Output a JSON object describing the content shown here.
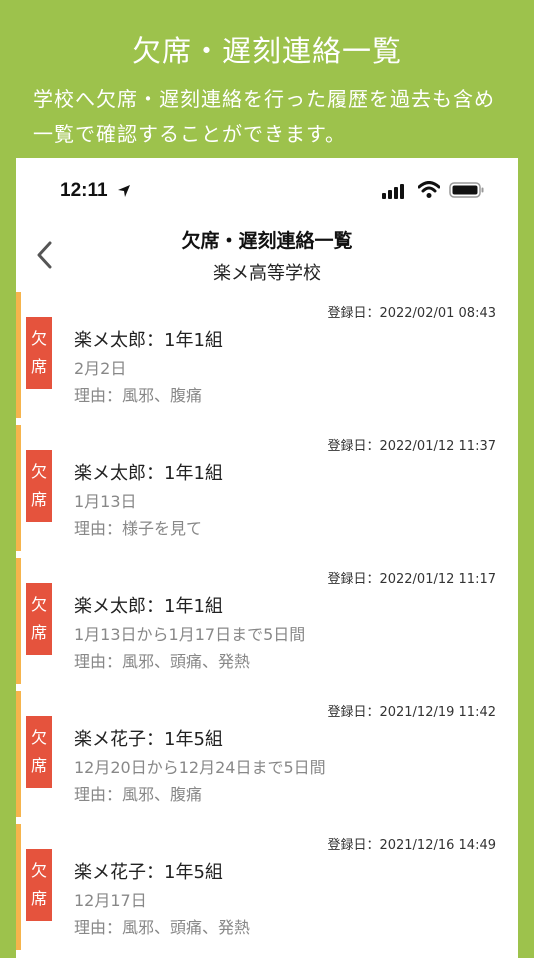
{
  "promo": {
    "title": "欠席・遅刻連絡一覧",
    "description": "学校へ欠席・遅刻連絡を行った履歴を過去も含め一覧で確認することができます。"
  },
  "status_bar": {
    "time": "12:11"
  },
  "nav": {
    "title": "欠席・遅刻連絡一覧",
    "subtitle": "楽メ高等学校"
  },
  "records": [
    {
      "badge": "欠席",
      "registered": "登録日：2022/02/01 08:43",
      "student": "楽メ太郎：1年1組",
      "dates": "2月2日",
      "reason": "理由：風邪、腹痛"
    },
    {
      "badge": "欠席",
      "registered": "登録日：2022/01/12 11:37",
      "student": "楽メ太郎：1年1組",
      "dates": "1月13日",
      "reason": "理由：様子を見て"
    },
    {
      "badge": "欠席",
      "registered": "登録日：2022/01/12 11:17",
      "student": "楽メ太郎：1年1組",
      "dates": "1月13日から1月17日まで5日間",
      "reason": "理由：風邪、頭痛、発熱"
    },
    {
      "badge": "欠席",
      "registered": "登録日：2021/12/19 11:42",
      "student": "楽メ花子：1年5組",
      "dates": "12月20日から12月24日まで5日間",
      "reason": "理由：風邪、腹痛"
    },
    {
      "badge": "欠席",
      "registered": "登録日：2021/12/16 14:49",
      "student": "楽メ花子：1年5組",
      "dates": "12月17日",
      "reason": "理由：風邪、頭痛、発熱"
    }
  ],
  "colors": {
    "background": "#9dc24c",
    "badge": "#e5533d",
    "stripe": "#f6b44c"
  },
  "icons": [
    "location-arrow-icon",
    "signal-icon",
    "wifi-icon",
    "battery-icon",
    "back-chevron-icon"
  ]
}
